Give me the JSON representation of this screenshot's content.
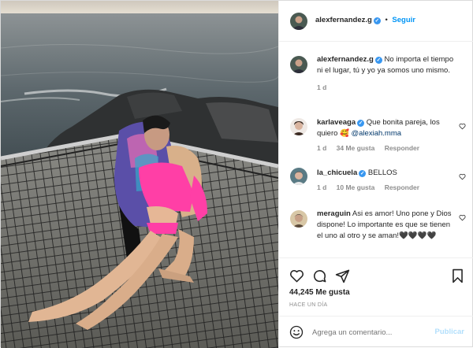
{
  "post": {
    "author": "alexfernandez.g",
    "follow_label": "Seguir",
    "separator": "•",
    "caption": "No importa el tiempo ni el lugar, tú y yo ya somos uno mismo.",
    "caption_age": "1 d"
  },
  "comments": [
    {
      "user": "karlaveaga",
      "text_before": "Que bonita pareja, los quiero 🥰 ",
      "mention": "@alexiah.mma",
      "age": "1 d",
      "likes": "34 Me gusta",
      "reply": "Responder",
      "verified": true
    },
    {
      "user": "la_chicuela",
      "text": "BELLOS",
      "age": "1 d",
      "likes": "10 Me gusta",
      "reply": "Responder",
      "verified": true
    },
    {
      "user": "meraguin",
      "text": "Asi es amor! Uno pone y Dios dispone! Lo importante es que se tienen el uno al otro y se aman!🖤🖤🖤🖤",
      "verified": false
    }
  ],
  "stats": {
    "likes": "44,245 Me gusta",
    "posted": "HACE UN DÍA"
  },
  "composer": {
    "placeholder": "Agrega un comentario...",
    "publish_label": "Publicar"
  },
  "icons": [
    "heart-icon",
    "comment-icon",
    "share-icon",
    "bookmark-icon",
    "emoji-icon",
    "verified-icon"
  ],
  "colors": {
    "accent": "#0095f6",
    "verified": "#3897f0",
    "muted": "#8e8e8e",
    "publish_disabled": "#b2dffc"
  }
}
